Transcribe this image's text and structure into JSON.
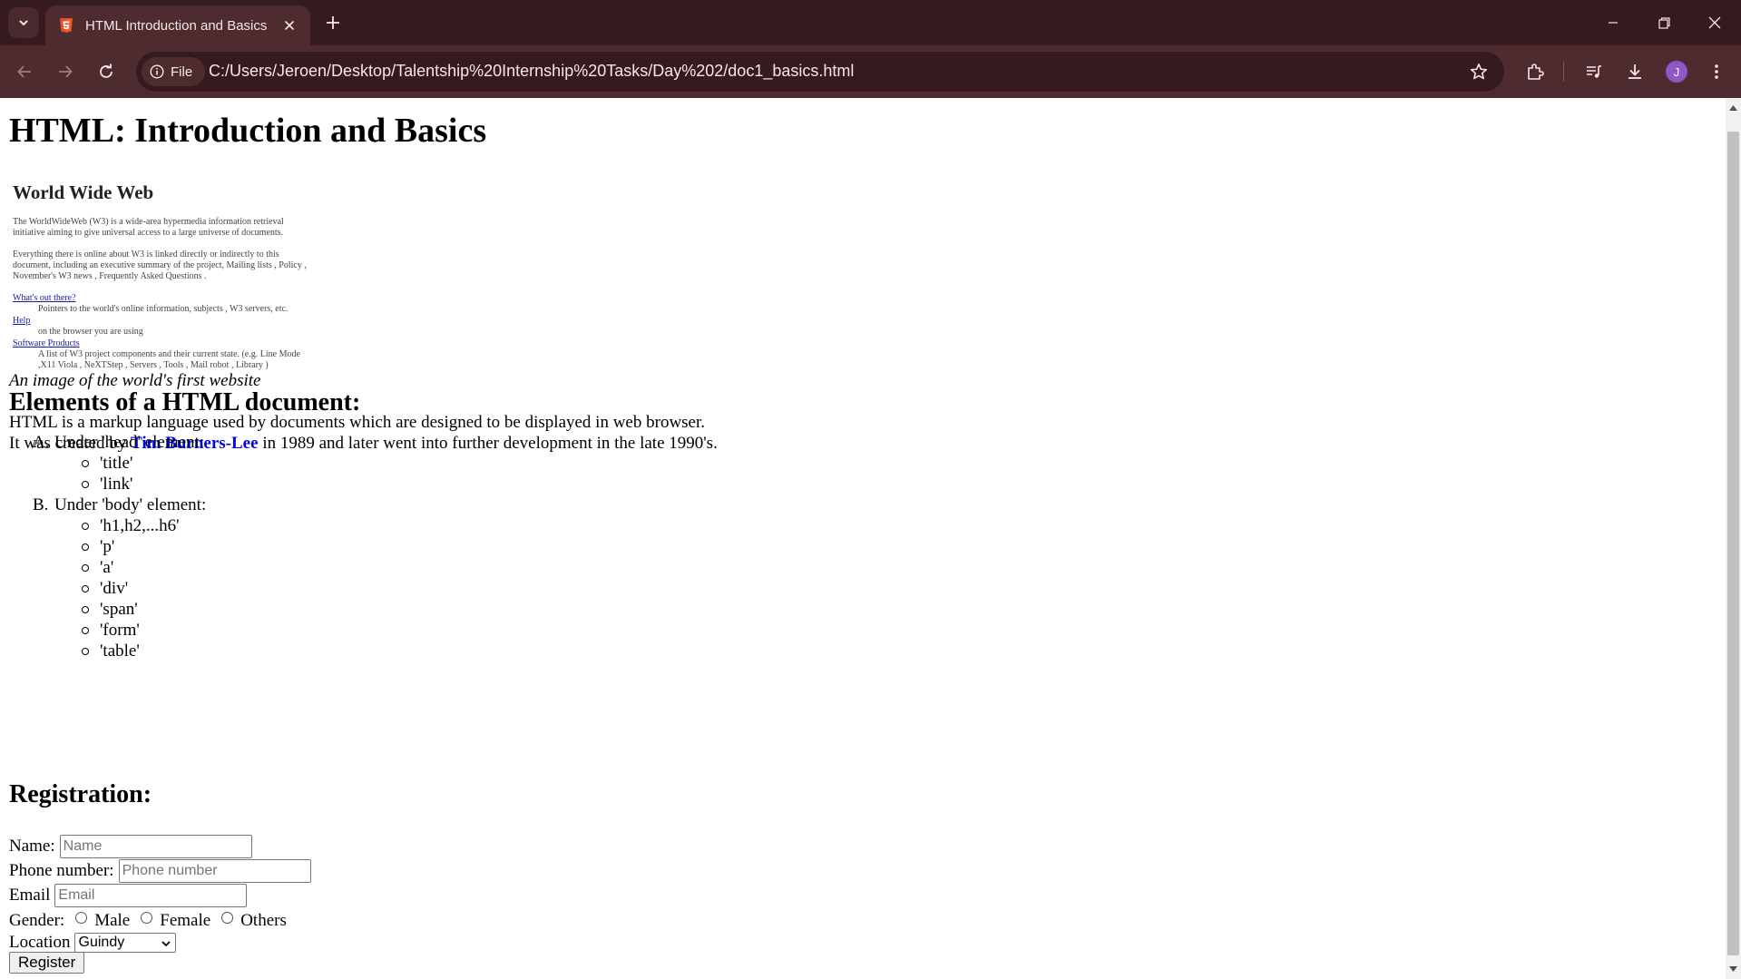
{
  "browser": {
    "tab_title": "HTML Introduction and Basics",
    "site_chip_label": "File",
    "url": "C:/Users/Jeroen/Desktop/Talentship%20Internship%20Tasks/Day%202/doc1_basics.html",
    "profile_initial": "J"
  },
  "page": {
    "title": "HTML: Introduction and Basics",
    "figure": {
      "heading": "World Wide Web",
      "lines": [
        "The WorldWideWeb (W3) is a wide-area hypermedia information retrieval",
        "initiative aiming to give universal access to a large universe of documents.",
        "Everything there is online about W3 is linked directly or indirectly to this",
        "document, including an executive summary of the project, Mailing lists , Policy ,",
        "November's W3 news , Frequently Asked Questions .",
        "What's out there?",
        "Pointers to the world's online information, subjects , W3 servers, etc.",
        "Help",
        "on the browser you are using",
        "Software Products",
        "A list of W3 project components and their current state. (e.g. Line Mode",
        ",X11 Viola , NeXTStep , Servers , Tools , Mail robot , Library )"
      ]
    },
    "caption": "An image of the world's first website",
    "para_line1": "HTML is a markup language used by documents which are designed to be displayed in web browser.",
    "para_line2_before": "It was created by ",
    "para_link": "Tim Burners-Lee",
    "para_line2_after": " in 1989 and later went into further development in the late 1990's.",
    "elements_heading": "Elements of a HTML document:",
    "list": {
      "a_marker": "A.",
      "a_label": "Under 'head' element:",
      "a_items": [
        "'title'",
        "'link'"
      ],
      "b_marker": "B.",
      "b_label": "Under 'body' element:",
      "b_items": [
        "'h1,h2,...h6'",
        "'p'",
        "'a'",
        "'div'",
        "'span'",
        "'form'",
        "'table'"
      ]
    },
    "registration_heading": "Registration:",
    "form": {
      "name_label": "Name:",
      "name_placeholder": "Name",
      "phone_label": "Phone number:",
      "phone_placeholder": "Phone number",
      "email_label": "Email",
      "email_placeholder": "Email",
      "gender_label": "Gender:",
      "gender_options": [
        "Male",
        "Female",
        "Others"
      ],
      "location_label": "Location",
      "location_value": "Guindy",
      "register_label": "Register"
    }
  }
}
